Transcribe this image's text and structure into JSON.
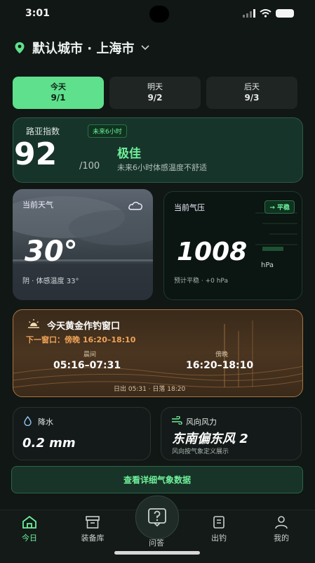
{
  "status": {
    "time": "3:01"
  },
  "location": {
    "label": "默认城市 · 上海市"
  },
  "day_tabs": [
    {
      "name": "今天",
      "date": "9/1"
    },
    {
      "name": "明天",
      "date": "9/2"
    },
    {
      "name": "后天",
      "date": "9/3"
    }
  ],
  "lure_index": {
    "title": "路亚指数",
    "badge": "未来6小时",
    "score": "92",
    "max": "/100",
    "grade": "极佳",
    "description": "未来6小时体感温度不舒适"
  },
  "weather": {
    "label": "当前天气",
    "icon": "cloud-icon",
    "temp": "30°",
    "desc": "阴 · 体感温度 33°"
  },
  "pressure": {
    "label": "当前气压",
    "trend_badge": "→ 平稳",
    "value": "1008",
    "unit": "hPa",
    "desc": "预计平稳 · +0 hPa"
  },
  "golden": {
    "title": "今天黄金作钓窗口",
    "next_window": "下一窗口：傍晚 16:20–18:10",
    "morning_label": "晨间",
    "morning_time": "05:16–07:31",
    "evening_label": "傍晚",
    "evening_time": "16:20–18:10",
    "sun_info": "日出 05:31 · 日落 18:20"
  },
  "precip": {
    "label": "降水",
    "value": "0.2 mm"
  },
  "wind": {
    "label": "风向风力",
    "value": "东南偏东风 2",
    "desc": "风向按气象定义展示"
  },
  "detail_button": "查看详细气象数据",
  "nav": [
    {
      "label": "今日",
      "icon": "home-icon"
    },
    {
      "label": "装备库",
      "icon": "box-icon"
    },
    {
      "label": "问答",
      "icon": "question-icon"
    },
    {
      "label": "出钓",
      "icon": "book-icon"
    },
    {
      "label": "我的",
      "icon": "user-icon"
    }
  ],
  "colors": {
    "accent": "#5fe08c",
    "background": "#101715",
    "gold_border": "#a97440"
  }
}
